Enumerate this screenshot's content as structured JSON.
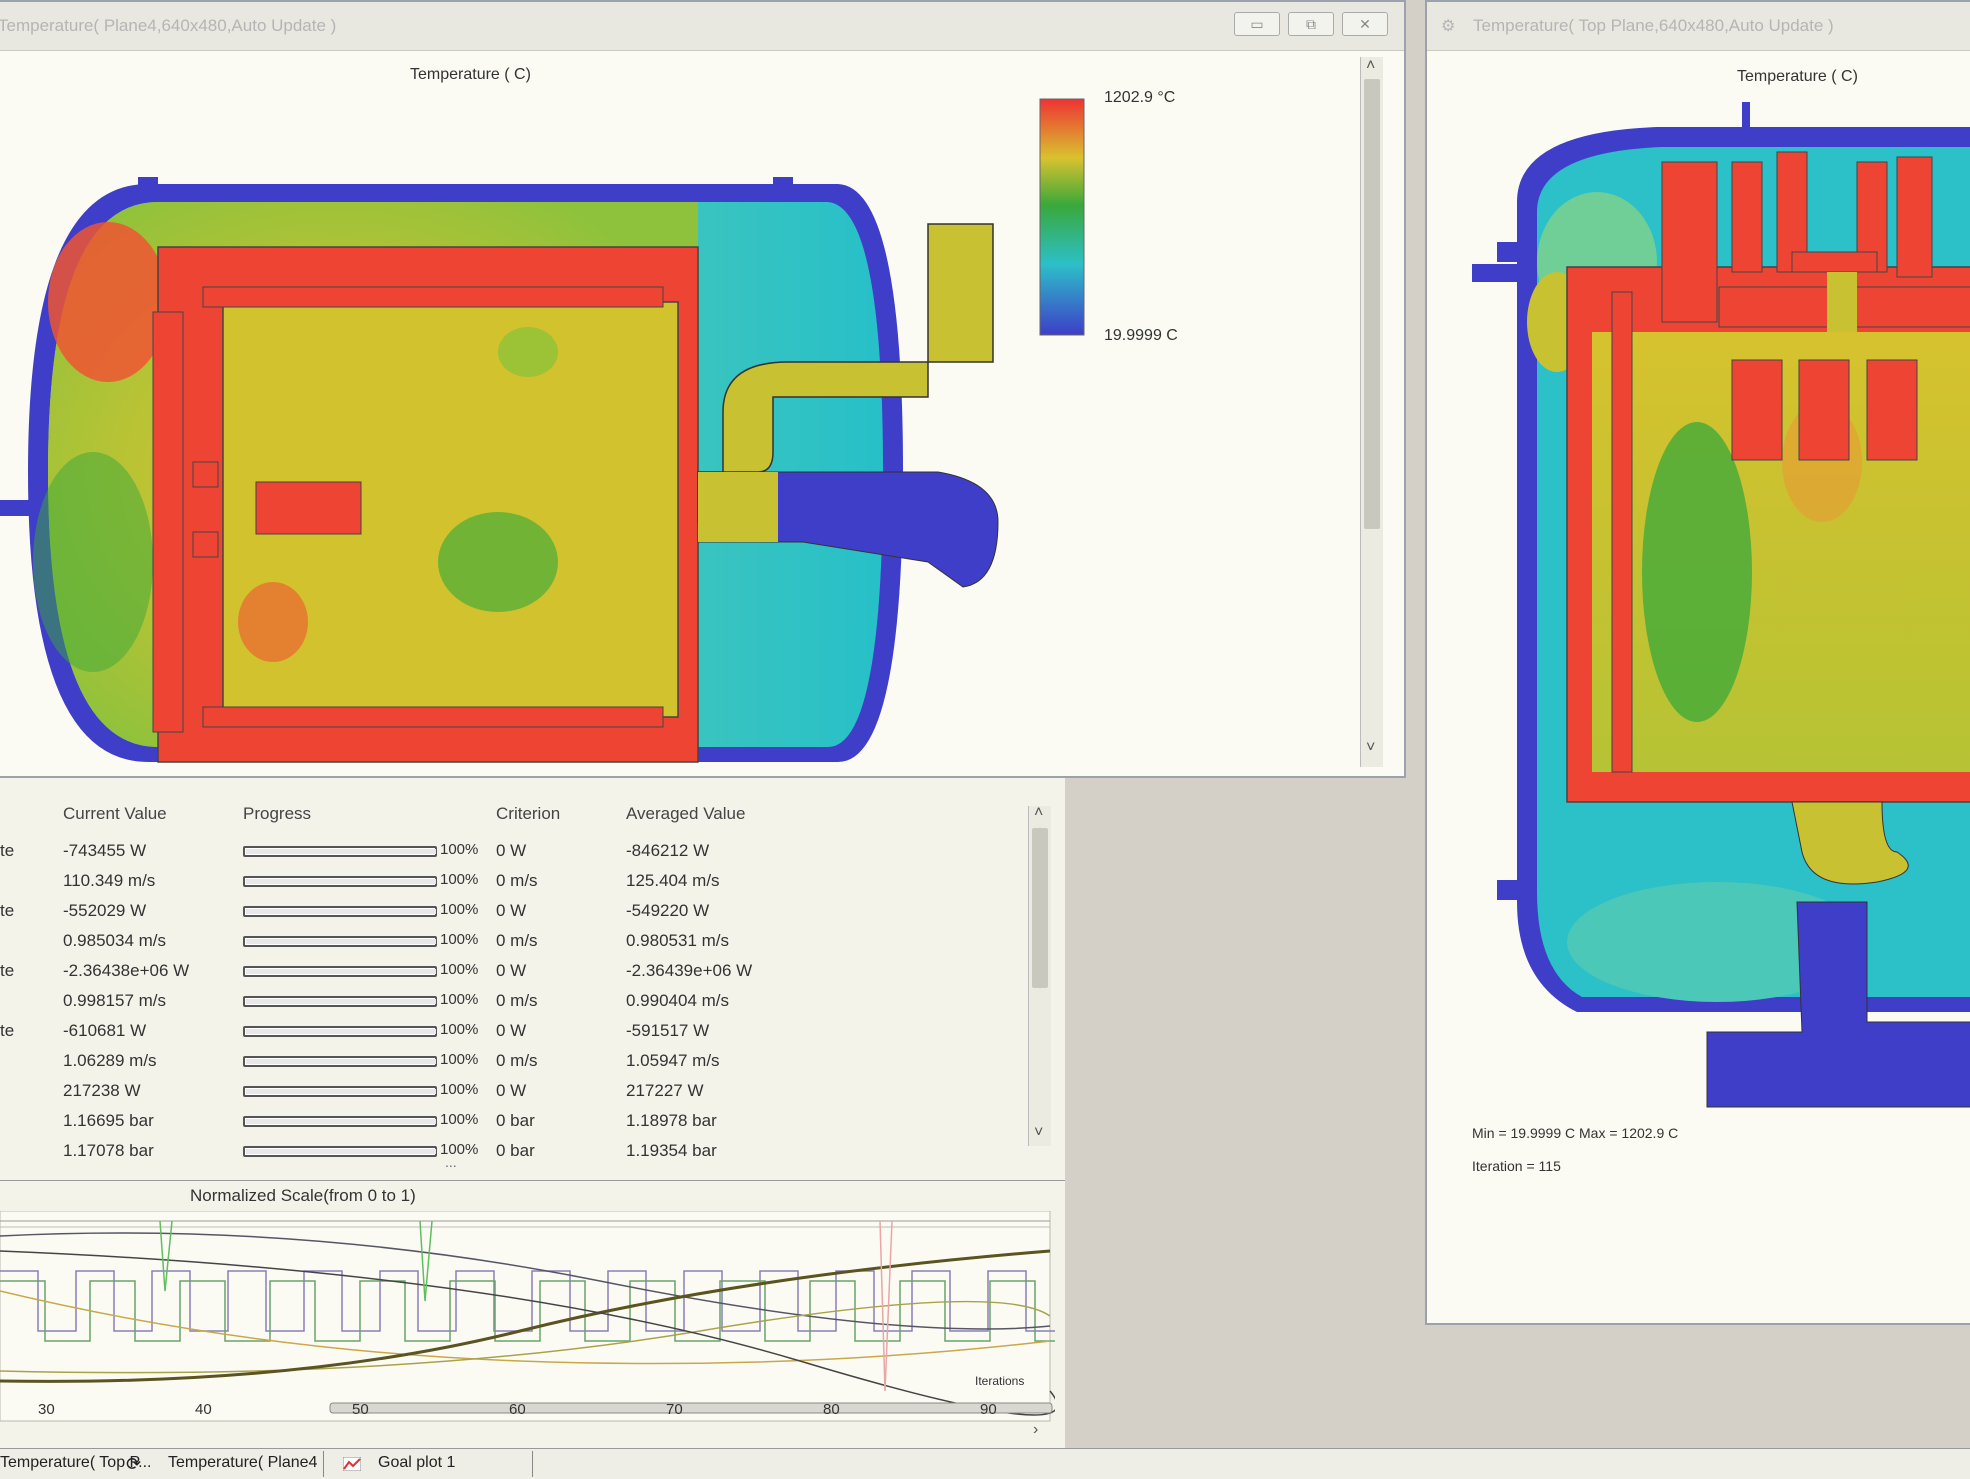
{
  "left_window": {
    "title": "Temperature( Plane4,640x480,Auto Update )",
    "chart_title": "Temperature ( C)",
    "legend_max": "1202.9 °C",
    "legend_min": "19.9999 C",
    "btn_minimize": "▭",
    "btn_restore": "⧉",
    "btn_close": "✕"
  },
  "right_window": {
    "title": "Temperature( Top Plane,640x480,Auto Update )",
    "chart_title": "Temperature ( C)",
    "stats_minmax": "Min = 19.9999 C   Max = 1202.9 C",
    "stats_iteration": "Iteration = 115"
  },
  "goals": {
    "headers": [
      "Current Value",
      "Progress",
      "Criterion",
      "Averaged Value"
    ],
    "rows": [
      {
        "name": "te",
        "current": "-743455 W",
        "pct": "100%",
        "criterion": "0 W",
        "averaged": "-846212 W"
      },
      {
        "name": "",
        "current": "110.349 m/s",
        "pct": "100%",
        "criterion": "0 m/s",
        "averaged": "125.404 m/s"
      },
      {
        "name": "te",
        "current": "-552029 W",
        "pct": "100%",
        "criterion": "0 W",
        "averaged": "-549220 W"
      },
      {
        "name": "",
        "current": "0.985034 m/s",
        "pct": "100%",
        "criterion": "0 m/s",
        "averaged": "0.980531 m/s"
      },
      {
        "name": "te",
        "current": "-2.36438e+06 W",
        "pct": "100%",
        "criterion": "0 W",
        "averaged": "-2.36439e+06 W"
      },
      {
        "name": "",
        "current": "0.998157 m/s",
        "pct": "100%",
        "criterion": "0 m/s",
        "averaged": "0.990404 m/s"
      },
      {
        "name": "te",
        "current": "-610681 W",
        "pct": "100%",
        "criterion": "0 W",
        "averaged": "-591517 W"
      },
      {
        "name": "",
        "current": "1.06289 m/s",
        "pct": "100%",
        "criterion": "0 m/s",
        "averaged": "1.05947 m/s"
      },
      {
        "name": "",
        "current": "217238 W",
        "pct": "100%",
        "criterion": "0 W",
        "averaged": "217227 W"
      },
      {
        "name": "",
        "current": "1.16695 bar",
        "pct": "100%",
        "criterion": "0 bar",
        "averaged": "1.18978 bar"
      },
      {
        "name": "",
        "current": "1.17078 bar",
        "pct": "100%",
        "criterion": "0 bar",
        "averaged": "1.19354 bar"
      }
    ],
    "progress_fraction": 1.0,
    "more": "..."
  },
  "goal_plot": {
    "title": "Normalized Scale(from 0 to 1)",
    "x_axis_label": "Iterations",
    "x_ticks": [
      "30",
      "40",
      "50",
      "60",
      "70",
      "80",
      "90"
    ]
  },
  "tabs": [
    {
      "label": "Temperature( Top P..."
    },
    {
      "label": "Temperature( Plane4"
    },
    {
      "label": "Goal plot 1"
    }
  ],
  "colors": {
    "hot": "#ee4433",
    "warm": "#c8c232",
    "mid": "#3aa83a",
    "cool": "#30bfc0",
    "cold": "#3e3ec8",
    "window_bg": "#fbfbf4"
  }
}
